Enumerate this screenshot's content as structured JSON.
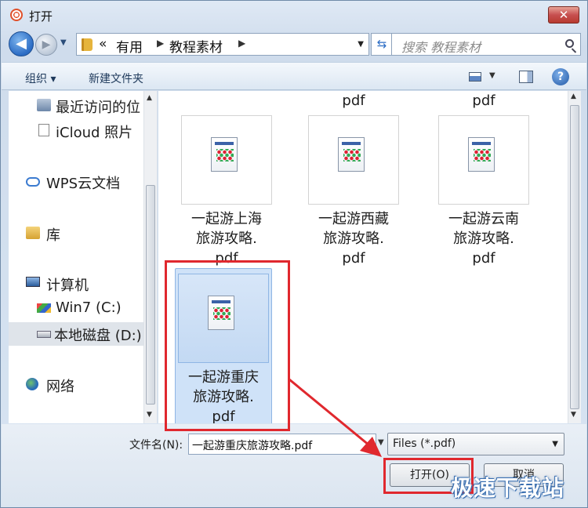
{
  "window": {
    "title": "打开",
    "close_label": "✕"
  },
  "nav": {
    "crumb_prefix": "«",
    "crumbs": [
      "有用",
      "教程素材"
    ],
    "search_placeholder": "搜索 教程素材"
  },
  "toolbar": {
    "organize": "组织 ▾",
    "new_folder": "新建文件夹",
    "help": "?"
  },
  "sidebar": {
    "items": [
      {
        "label": "最近访问的位",
        "icon": "recent-places-icon"
      },
      {
        "label": "iCloud 照片",
        "icon": "icloud-photos-icon"
      },
      {
        "label": "WPS云文档",
        "icon": "wps-cloud-icon"
      },
      {
        "label": "库",
        "icon": "library-icon"
      },
      {
        "label": "计算机",
        "icon": "computer-icon"
      },
      {
        "label": "Win7 (C:)",
        "icon": "drive-c-icon"
      },
      {
        "label": "本地磁盘 (D:)",
        "icon": "drive-d-icon"
      },
      {
        "label": "网络",
        "icon": "network-icon"
      }
    ]
  },
  "files": {
    "partial_top": [
      "pdf",
      "pdf"
    ],
    "items": [
      {
        "name_lines": [
          "一起游上海",
          "旅游攻略.",
          "pdf"
        ]
      },
      {
        "name_lines": [
          "一起游西藏",
          "旅游攻略.",
          "pdf"
        ]
      },
      {
        "name_lines": [
          "一起游云南",
          "旅游攻略.",
          "pdf"
        ]
      },
      {
        "name_lines": [
          "一起游重庆",
          "旅游攻略.",
          "pdf"
        ],
        "selected": true
      }
    ]
  },
  "footer": {
    "filename_label": "文件名(N):",
    "filename_value": "一起游重庆旅游攻略.pdf",
    "filter_value": "Files (*.pdf)",
    "open_button": "打开(O)",
    "cancel_button": "取消"
  },
  "watermark": "极速下载站",
  "colors": {
    "highlight": "#e0282e",
    "selection": "#cfe2f8"
  }
}
